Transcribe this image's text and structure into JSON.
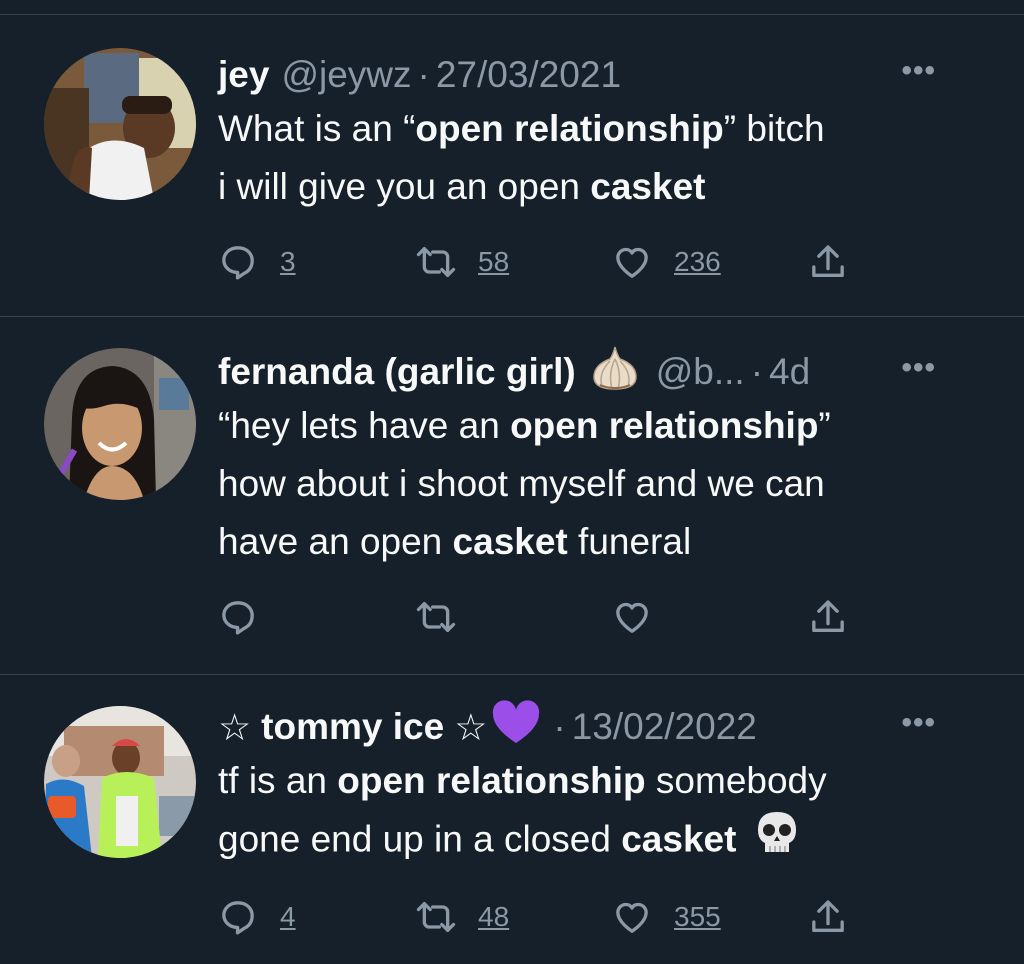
{
  "tweets": [
    {
      "name": "jey",
      "handle": "@jeywz",
      "sep": "·",
      "date": "27/03/2021",
      "more": "•••",
      "text_parts": [
        [
          "What is an “",
          "open relationship",
          "” bitch"
        ],
        [
          "i will give you an open ",
          "casket",
          ""
        ]
      ],
      "replies": "3",
      "retweets": "58",
      "likes": "236"
    },
    {
      "name": "fernanda (garlic girl)",
      "name_emoji": "garlic-emoji",
      "handle": "@b...",
      "sep": "·",
      "date": "4d",
      "more": "•••",
      "text_parts": [
        [
          "“hey lets have an ",
          "open relationship",
          "”"
        ],
        [
          "how about i shoot myself and we can"
        ],
        [
          "have an open ",
          "casket",
          " funeral"
        ]
      ],
      "replies": "",
      "retweets": "",
      "likes": ""
    },
    {
      "name_prefix": "☆",
      "name": "tommy ice",
      "name_suffix": "☆",
      "name_emoji": "purple-heart-emoji",
      "sep": "·",
      "date": "13/02/2022",
      "more": "•••",
      "text_parts": [
        [
          "tf is an ",
          "open relationship",
          " somebody"
        ],
        [
          "gone end up in a closed ",
          "casket",
          ""
        ]
      ],
      "text_emoji": "skull-emoji",
      "replies": "4",
      "retweets": "48",
      "likes": "355"
    }
  ],
  "colors": {
    "background": "#15202b",
    "divider": "#38444d",
    "text": "#f7f9f9",
    "muted": "#8b98a5"
  },
  "icons": [
    "reply-icon",
    "retweet-icon",
    "like-icon",
    "share-icon",
    "more-icon"
  ]
}
